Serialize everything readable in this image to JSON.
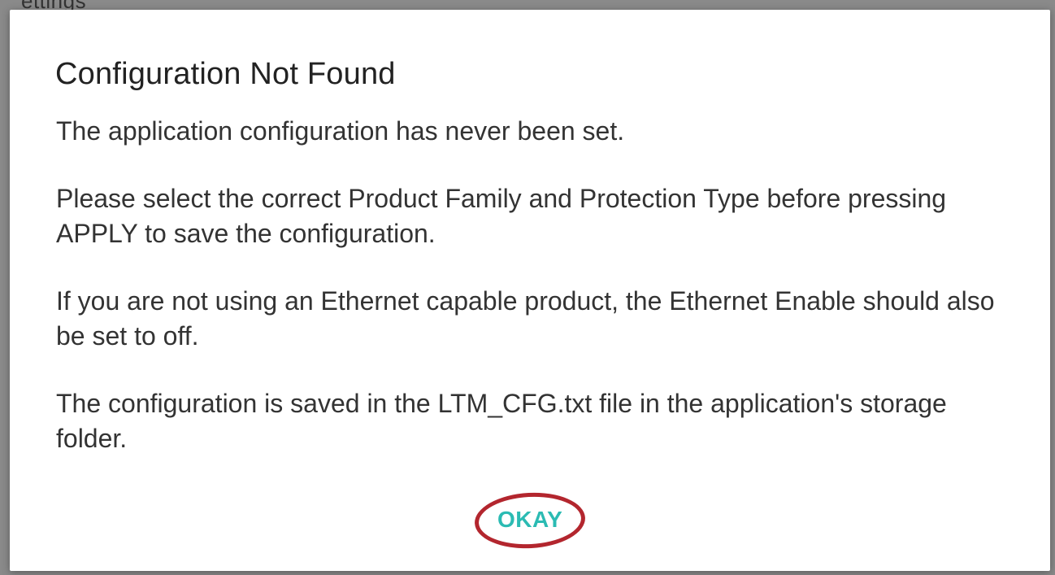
{
  "background": {
    "peek_text": "ettings"
  },
  "dialog": {
    "title": "Configuration Not Found",
    "paragraphs": [
      "The application configuration has never been set.",
      "Please select the correct Product Family and Protection Type before pressing APPLY to save the configuration.",
      "If you are not using an Ethernet capable product, the Ethernet Enable should also be set to off.",
      "The configuration is saved in the LTM_CFG.txt file in the application's storage folder."
    ],
    "okay_label": "OKAY"
  },
  "colors": {
    "accent": "#2bbbb3",
    "highlight_circle": "#b3262e",
    "title_text": "#222222",
    "body_text": "#333333"
  }
}
